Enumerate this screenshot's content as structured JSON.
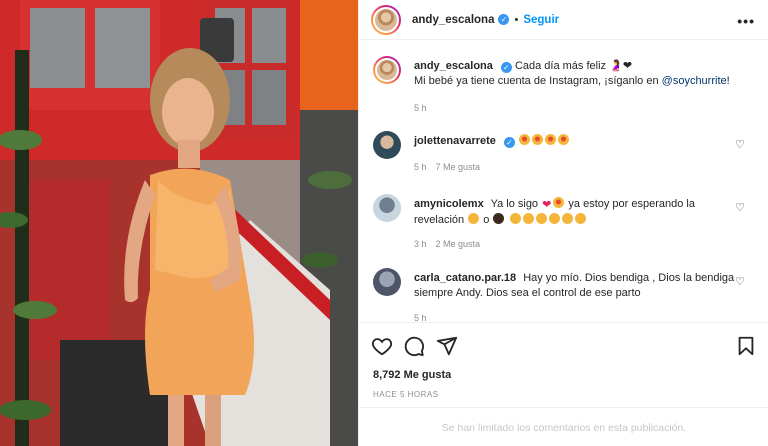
{
  "header": {
    "username": "andy_escalona",
    "separator": "•",
    "follow_label": "Seguir",
    "more_icon": "more-horizontal-icon"
  },
  "caption": {
    "username": "andy_escalona",
    "line1": "Cada día más feliz",
    "line2_before": "Mi bebé ya tiene cuenta de Instagram, ¡síganlo en ",
    "mention": "@soychurrite",
    "line2_after": "!",
    "time": "5 h"
  },
  "comments": [
    {
      "username": "jolettenavarrete",
      "verified": true,
      "time": "5 h",
      "likes": "7 Me gusta"
    },
    {
      "username": "amynicolemx",
      "text_a": "Ya lo sigo",
      "text_b": "ya estoy por esperando la",
      "text_c": "revelación",
      "text_d": "o",
      "time": "3 h",
      "likes": "2 Me gusta"
    },
    {
      "username": "carla_catano.par.18",
      "text": "Hay yo mío. Dios bendiga , Dios la bendiga siempre Andy. Dios sea el control de ese parto",
      "time": "5 h"
    }
  ],
  "actions": {
    "likes": "8,792 Me gusta",
    "ago": "HACE 5 HORAS",
    "comments_limited": "Se han limitado los comentarios en esta publicación."
  },
  "colors": {
    "link": "#0095f6",
    "mention": "#00376b",
    "muted": "#8e8e8e"
  }
}
